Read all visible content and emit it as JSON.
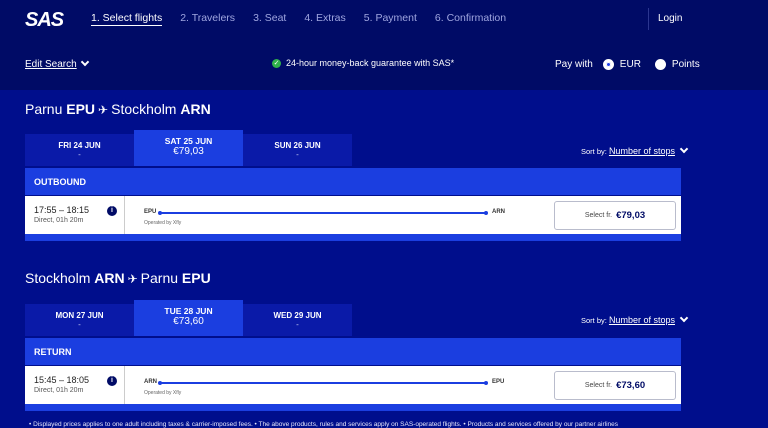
{
  "brand": "SAS",
  "steps": [
    "1. Select flights",
    "2. Travelers",
    "3. Seat",
    "4. Extras",
    "5. Payment",
    "6. Confirmation"
  ],
  "login": "Login",
  "edit_search": "Edit Search",
  "guarantee": "24-hour money-back guarantee with SAS*",
  "pay_with": {
    "label": "Pay with",
    "options": [
      "EUR",
      "Points"
    ],
    "selected": "EUR"
  },
  "outbound": {
    "from_city": "Parnu",
    "from_code": "EPU",
    "to_city": "Stockholm",
    "to_code": "ARN",
    "dates": [
      {
        "label": "FRI 24 JUN",
        "price": "-"
      },
      {
        "label": "SAT 25 JUN",
        "price": "€79,03"
      },
      {
        "label": "SUN 26 JUN",
        "price": "-"
      }
    ],
    "sort_label": "Sort by:",
    "sort_value": "Number of stops",
    "direction": "OUTBOUND",
    "flight": {
      "time": "17:55 – 18:15",
      "duration": "Direct, 01h 20m",
      "from": "EPU",
      "to": "ARN",
      "operator": "Operated by Xfly",
      "select_label": "Select fr.",
      "price": "€79,03"
    }
  },
  "return": {
    "from_city": "Stockholm",
    "from_code": "ARN",
    "to_city": "Parnu",
    "to_code": "EPU",
    "dates": [
      {
        "label": "MON 27 JUN",
        "price": "-"
      },
      {
        "label": "TUE 28 JUN",
        "price": "€73,60"
      },
      {
        "label": "WED 29 JUN",
        "price": "-"
      }
    ],
    "sort_label": "Sort by:",
    "sort_value": "Number of stops",
    "direction": "RETURN",
    "flight": {
      "time": "15:45 – 18:05",
      "duration": "Direct, 01h 20m",
      "from": "ARN",
      "to": "EPU",
      "operator": "Operated by Xfly",
      "select_label": "Select fr.",
      "price": "€73,60"
    }
  },
  "disclaimer": "• Displayed prices applies to one adult including taxes & carrier-imposed fees. • The above products, rules and services apply on SAS-operated flights. • Products and services offered by our partner airlines"
}
